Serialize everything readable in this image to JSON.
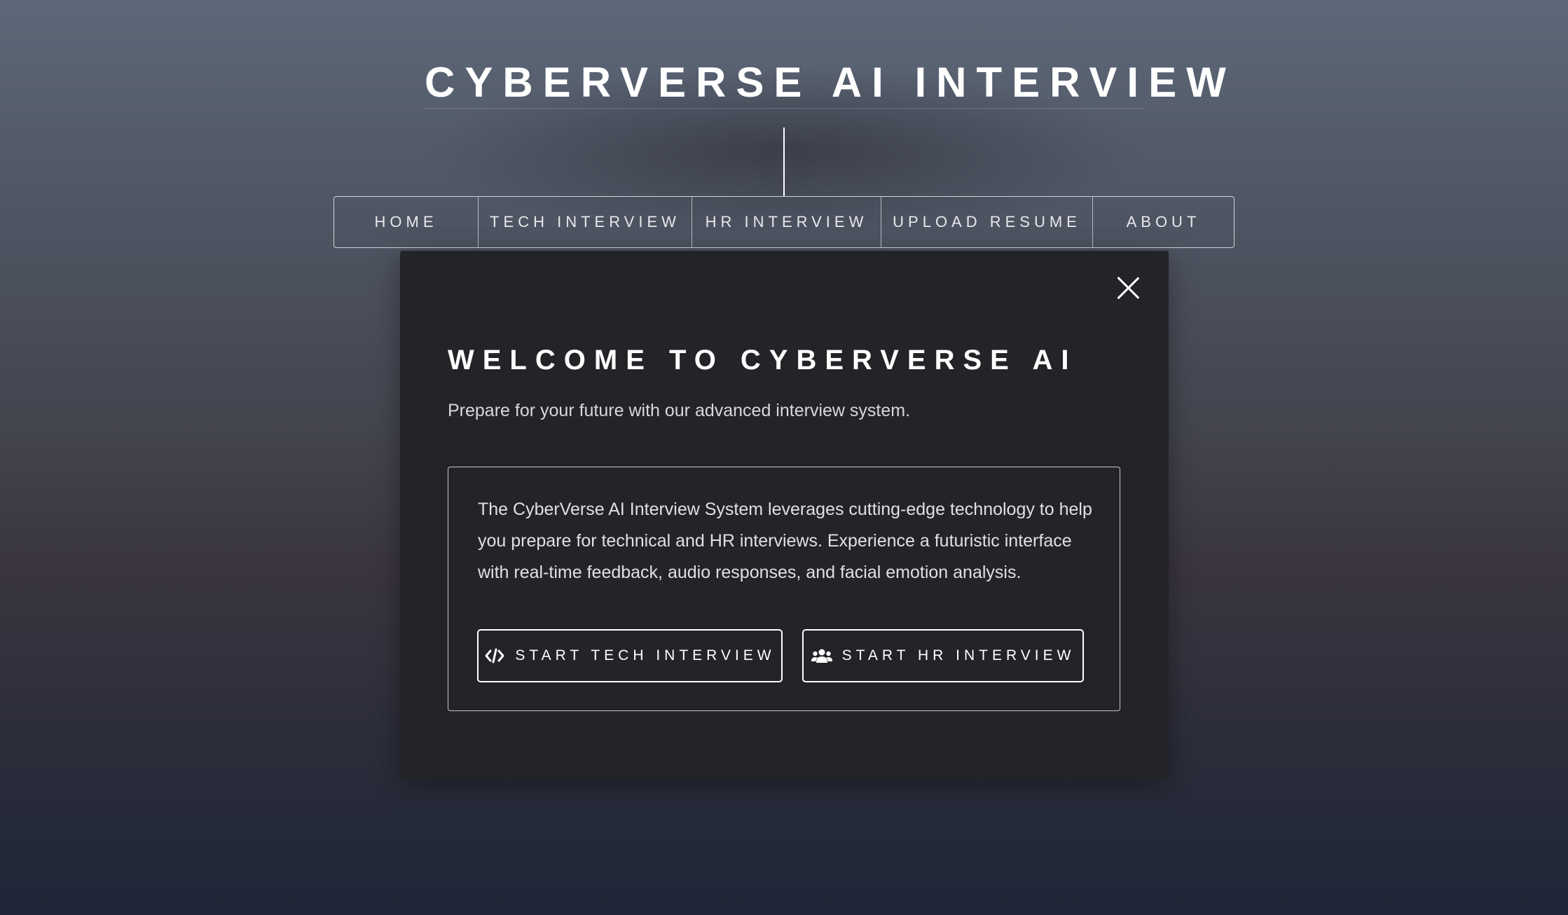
{
  "header": {
    "title": "CYBERVERSE AI INTERVIEW"
  },
  "nav": {
    "items": [
      {
        "label": "HOME"
      },
      {
        "label": "TECH INTERVIEW"
      },
      {
        "label": "HR INTERVIEW"
      },
      {
        "label": "UPLOAD RESUME"
      },
      {
        "label": "ABOUT"
      }
    ]
  },
  "modal": {
    "title": "WELCOME TO CYBERVERSE AI",
    "subtitle": "Prepare for your future with our advanced interview system.",
    "description": "The CyberVerse AI Interview System leverages cutting-edge technology to help you prepare for technical and HR interviews. Experience a futuristic interface with real-time feedback, audio responses, and facial emotion analysis.",
    "close_icon": "close-icon",
    "buttons": {
      "tech": {
        "label": "START TECH INTERVIEW",
        "icon": "code-icon"
      },
      "hr": {
        "label": "START HR INTERVIEW",
        "icon": "users-icon"
      }
    }
  },
  "colors": {
    "modal_background": "#232428",
    "text": "#ffffff",
    "border": "#ffffff"
  }
}
